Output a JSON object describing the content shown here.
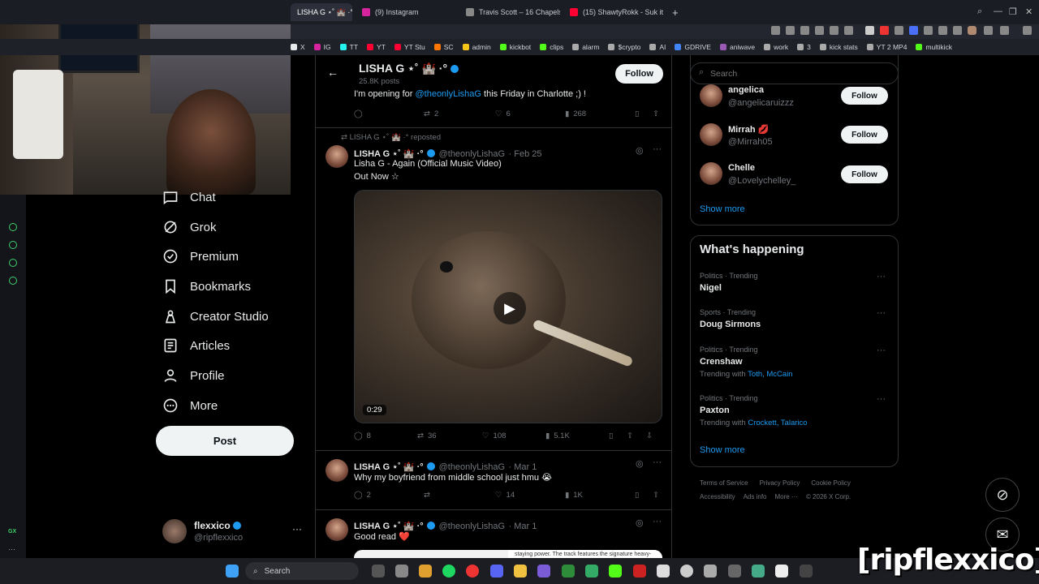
{
  "browser": {
    "tabs": [
      {
        "label": "LISHA G ⋆˚ 🏰 ·° (@the",
        "active": true,
        "color": "#e7e9ea"
      },
      {
        "label": "(9) Instagram",
        "active": false,
        "color": "#d6249f"
      },
      {
        "label": "Travis Scott – 16 Chapels",
        "active": false,
        "color": "#e7e9ea"
      },
      {
        "label": "(15) ShawtyRokk - Suk it S",
        "active": false,
        "color": "#ff0033"
      }
    ],
    "new_tab": "+",
    "bookmarks": [
      {
        "label": "X",
        "color": "#e7e9ea"
      },
      {
        "label": "IG",
        "color": "#d6249f"
      },
      {
        "label": "TT",
        "color": "#25f4ee"
      },
      {
        "label": "YT",
        "color": "#ff0033"
      },
      {
        "label": "YT Stu",
        "color": "#ff0033"
      },
      {
        "label": "SC",
        "color": "#ff7700"
      },
      {
        "label": "admin",
        "color": "#f5c518"
      },
      {
        "label": "kickbot",
        "color": "#53fc18"
      },
      {
        "label": "clips",
        "color": "#53fc18"
      },
      {
        "label": "alarm",
        "color": "#aaaaaa"
      },
      {
        "label": "$crypto",
        "color": "#aaaaaa"
      },
      {
        "label": "AI",
        "color": "#aaaaaa"
      },
      {
        "label": "GDRIVE",
        "color": "#4285f4"
      },
      {
        "label": "aniwave",
        "color": "#9b59b6"
      },
      {
        "label": "work",
        "color": "#aaaaaa"
      },
      {
        "label": "3",
        "color": "#aaaaaa"
      },
      {
        "label": "kick stats",
        "color": "#aaaaaa"
      },
      {
        "label": "YT 2 MP4",
        "color": "#aaaaaa"
      },
      {
        "label": "multikick",
        "color": "#53fc18"
      }
    ]
  },
  "nav": {
    "items": [
      {
        "label": "Chat",
        "icon": "chat-icon"
      },
      {
        "label": "Grok",
        "icon": "grok-icon"
      },
      {
        "label": "Premium",
        "icon": "premium-icon"
      },
      {
        "label": "Bookmarks",
        "icon": "bookmark-icon"
      },
      {
        "label": "Creator Studio",
        "icon": "creator-studio-icon"
      },
      {
        "label": "Articles",
        "icon": "articles-icon"
      },
      {
        "label": "Profile",
        "icon": "profile-icon"
      },
      {
        "label": "More",
        "icon": "more-circle-icon"
      }
    ],
    "post_label": "Post",
    "account": {
      "name": "flexxico",
      "handle": "@ripflexxico",
      "more": "···"
    }
  },
  "profile_header": {
    "name": "LISHA G ⋆˚ 🏰 ·°",
    "posts": "25.8K posts",
    "follow_label": "Follow"
  },
  "tweets": {
    "t0": {
      "text_prefix": "I'm opening for ",
      "mention": "@theonlyLishaG",
      "text_suffix": " this Friday in Charlotte ;) !",
      "replies": "",
      "reposts": "2",
      "likes": "6",
      "views": "268"
    },
    "t1": {
      "repost_note": "LISHA G ⋆˚ 🏰 ·° reposted",
      "name": "LISHA G ⋆˚ 🏰 ·°",
      "handle": "@theonlyLishaG",
      "date": "· Feb 25",
      "line1": "Lisha G - Again (Official Music Video)",
      "line2": "Out Now ☆",
      "duration": "0:29",
      "replies": "8",
      "reposts": "36",
      "likes": "108",
      "views": "5.1K"
    },
    "t2": {
      "name": "LISHA G ⋆˚ 🏰 ·°",
      "handle": "@theonlyLishaG",
      "date": "· Mar 1",
      "text": "Why my boyfriend from middle school just hmu 😭",
      "replies": "2",
      "reposts": "",
      "likes": "14",
      "views": "1K"
    },
    "t3": {
      "name": "LISHA G ⋆˚ 🏰 ·°",
      "handle": "@theonlyLishaG",
      "date": "· Mar 1",
      "text": "Good read ❤️",
      "preview": "staying power. The track features the signature heavy-"
    }
  },
  "search": {
    "placeholder": "Search"
  },
  "who_to_follow": {
    "items": [
      {
        "name": "angelica",
        "handle": "@angelicaruizzz",
        "follow": "Follow"
      },
      {
        "name": "Mirrah 💋",
        "handle": "@Mirrah05",
        "follow": "Follow"
      },
      {
        "name": "Chelle",
        "handle": "@Lovelychelley_",
        "follow": "Follow"
      }
    ],
    "show_more": "Show more"
  },
  "happening": {
    "title": "What's happening",
    "trends": [
      {
        "meta": "Politics · Trending",
        "name": "Nigel",
        "with_label": "",
        "with": ""
      },
      {
        "meta": "Sports · Trending",
        "name": "Doug Sirmons",
        "with_label": "",
        "with": ""
      },
      {
        "meta": "Politics · Trending",
        "name": "Crenshaw",
        "with_label": "Trending with",
        "with": "Toth, McCain"
      },
      {
        "meta": "Politics · Trending",
        "name": "Paxton",
        "with_label": "Trending with",
        "with": "Crockett, Talarico"
      }
    ],
    "show_more": "Show more"
  },
  "footer": {
    "terms": "Terms of Service",
    "privacy": "Privacy Policy",
    "cookie": "Cookie Policy",
    "accessibility": "Accessibility",
    "ads": "Ads info",
    "more": "More ···",
    "copyright": "© 2026 X Corp."
  },
  "taskbar": {
    "search_label": "Search"
  },
  "watermark": "[ripflexxico]"
}
